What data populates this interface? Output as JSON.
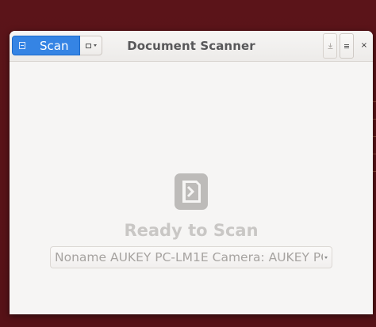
{
  "window": {
    "title": "Document Scanner"
  },
  "headerbar": {
    "scan_button_label": "Scan",
    "scan_button_icon": "scanner-icon",
    "scan_type_icon": "page-icon",
    "save_icon": "download-icon",
    "menu_icon": "hamburger-icon",
    "close_symbol": "×"
  },
  "main": {
    "status_icon": "document-icon",
    "status_text": "Ready to Scan",
    "device_selector": {
      "selected": "Noname AUKEY PC-LM1E Camera: AUKEY PC-"
    }
  },
  "colors": {
    "accent": "#3584e4",
    "desktop_background": "#5a1418",
    "window_background": "#f6f5f4",
    "placeholder_text": "#c9c7c5"
  }
}
